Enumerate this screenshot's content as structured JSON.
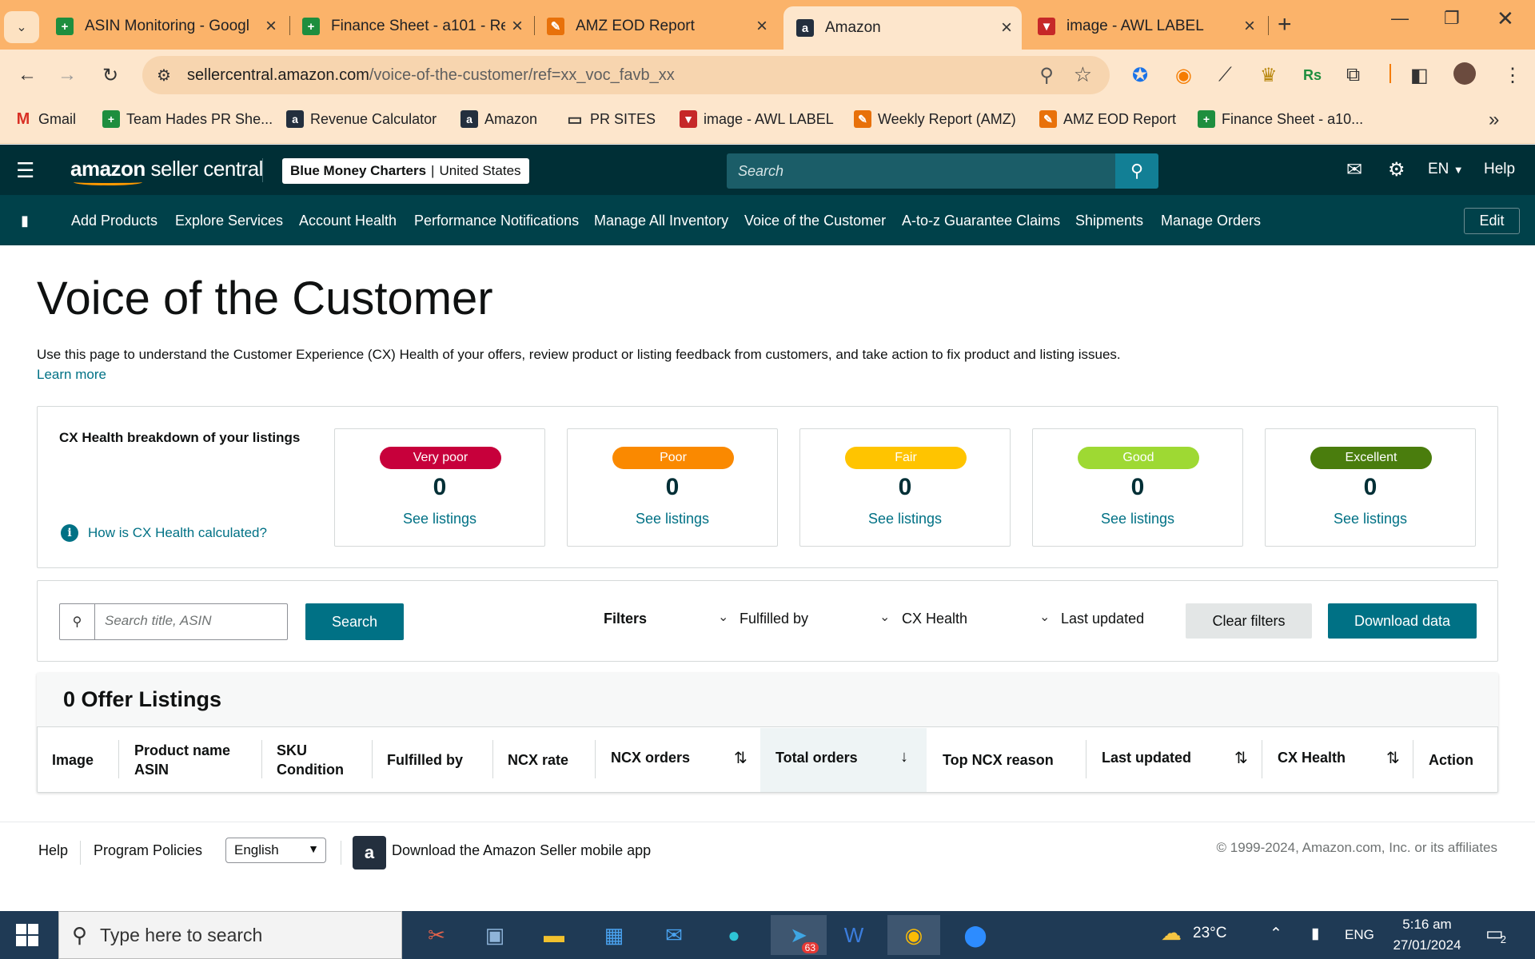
{
  "browser": {
    "tabs": [
      {
        "title": "ASIN Monitoring - Googl",
        "icon": "sheets-icon"
      },
      {
        "title": "Finance Sheet - a101 - Re",
        "icon": "sheets-icon"
      },
      {
        "title": "AMZ EOD Report",
        "icon": "tool-icon"
      },
      {
        "title": "Amazon",
        "icon": "amazon-icon"
      },
      {
        "title": "image - AWL LABEL",
        "icon": "awl-icon"
      }
    ],
    "url_host": "sellercentral.amazon.com",
    "url_path": "/voice-of-the-customer/ref=xx_voc_favb_xx",
    "bookmarks": [
      "Gmail",
      "Team Hades PR She...",
      "Revenue Calculator",
      "Amazon",
      "PR SITES",
      "image - AWL LABEL",
      "Weekly Report (AMZ)",
      "AMZ EOD Report",
      "Finance Sheet - a10..."
    ]
  },
  "header": {
    "logo_a": "amazon",
    "logo_b": "seller central",
    "store_name": "Blue Money Charters",
    "store_pipe": "|",
    "store_region": "United States",
    "search_placeholder": "Search",
    "lang": "EN",
    "help": "Help"
  },
  "nav": [
    "Add Products",
    "Explore Services",
    "Account Health",
    "Performance Notifications",
    "Manage All Inventory",
    "Voice of the Customer",
    "A-to-z Guarantee Claims",
    "Shipments",
    "Manage Orders"
  ],
  "nav_edit": "Edit",
  "page": {
    "title": "Voice of the Customer",
    "description": "Use this page to understand the Customer Experience (CX) Health of your offers, review product or listing feedback from customers, and take action to fix product and listing issues.",
    "learn_more": "Learn more"
  },
  "cx": {
    "title": "CX Health breakdown of your listings",
    "how": "How is CX Health calculated?",
    "link_label": "See listings",
    "cards": [
      {
        "label": "Very poor",
        "count": "0",
        "color": "#c7003b"
      },
      {
        "label": "Poor",
        "count": "0",
        "color": "#fa8900"
      },
      {
        "label": "Fair",
        "count": "0",
        "color": "#ffc400"
      },
      {
        "label": "Good",
        "count": "0",
        "color": "#9ed933"
      },
      {
        "label": "Excellent",
        "count": "0",
        "color": "#4a7d0d"
      }
    ]
  },
  "filters": {
    "search_placeholder": "Search title, ASIN",
    "search_btn": "Search",
    "filters_label": "Filters",
    "fulfilled_by": "Fulfilled by",
    "cx_health": "CX Health",
    "last_updated": "Last updated",
    "clear": "Clear filters",
    "download": "Download data"
  },
  "table": {
    "count_title": "0 Offer Listings",
    "col_image": "Image",
    "col_product": "Product name",
    "col_asin": "ASIN",
    "col_sku": "SKU",
    "col_condition": "Condition",
    "col_fulfilled": "Fulfilled by",
    "col_ncx_rate": "NCX rate",
    "col_ncx_orders": "NCX orders",
    "col_total_orders": "Total orders",
    "col_top_reason": "Top NCX reason",
    "col_last_updated": "Last updated",
    "col_cx_health": "CX Health",
    "col_action": "Action"
  },
  "footer": {
    "help": "Help",
    "policies": "Program Policies",
    "language": "English",
    "app": "Download the Amazon Seller mobile app",
    "copyright": "© 1999-2024, Amazon.com, Inc. or its affiliates"
  },
  "taskbar": {
    "search_placeholder": "Type here to search",
    "telegram_badge": "63",
    "temp": "23°C",
    "lang": "ENG",
    "time": "5:16 am",
    "date": "27/01/2024",
    "notifications": "2"
  }
}
